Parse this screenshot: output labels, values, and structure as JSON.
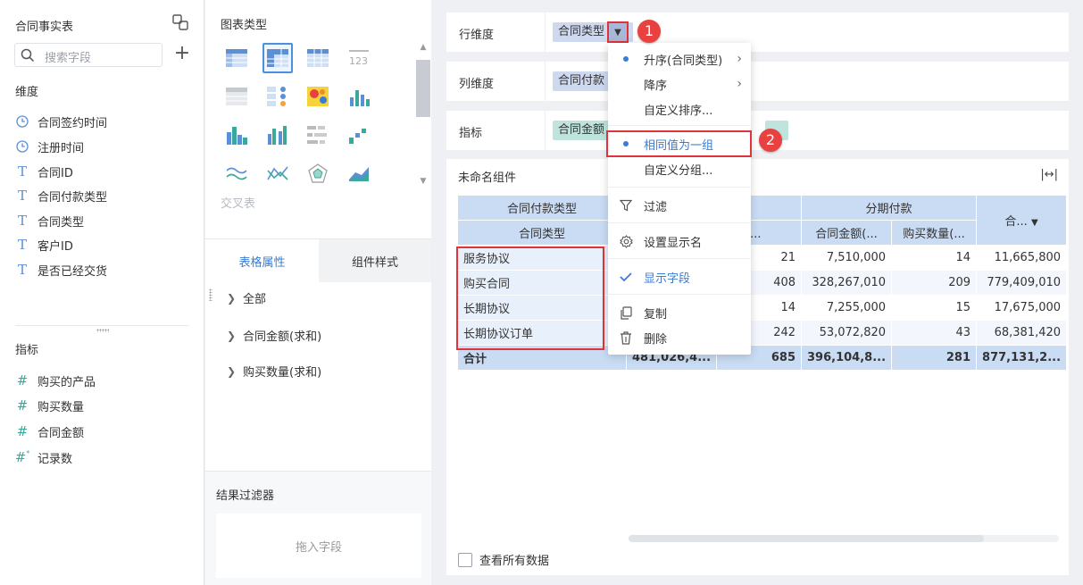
{
  "left_panel": {
    "dataset_title": "合同事实表",
    "search_placeholder": "搜索字段",
    "dimensions_title": "维度",
    "dimensions": [
      {
        "label": "合同签约时间",
        "icon": "clock-icon"
      },
      {
        "label": "注册时间",
        "icon": "clock-icon"
      },
      {
        "label": "合同ID",
        "icon": "text-type-icon"
      },
      {
        "label": "合同付款类型",
        "icon": "text-type-icon"
      },
      {
        "label": "合同类型",
        "icon": "text-type-icon"
      },
      {
        "label": "客户ID",
        "icon": "text-type-icon"
      },
      {
        "label": "是否已经交货",
        "icon": "text-type-icon"
      }
    ],
    "metrics_title": "指标",
    "metrics": [
      {
        "label": "购买的产品",
        "icon": "number-type-icon"
      },
      {
        "label": "购买数量",
        "icon": "number-type-icon"
      },
      {
        "label": "合同金额",
        "icon": "number-type-icon"
      },
      {
        "label": "记录数",
        "icon": "record-count-icon"
      }
    ]
  },
  "middle_panel": {
    "chart_type_title": "图表类型",
    "cross_table_label": "交叉表",
    "tabs": {
      "table_properties": "表格属性",
      "component_style": "组件样式"
    },
    "properties": [
      "全部",
      "合同金额(求和)",
      "购买数量(求和)"
    ],
    "result_filter_title": "结果过滤器",
    "drop_field_hint": "拖入字段"
  },
  "config": {
    "row_dim_label": "行维度",
    "row_dim_pill": "合同类型",
    "col_dim_label": "列维度",
    "col_dim_pill": "合同付款",
    "metric_label": "指标",
    "metric_pill": "合同金额"
  },
  "widget": {
    "title": "未命名组件",
    "header": {
      "payment_type": "合同付款类型",
      "contract_type": "合同类型",
      "qty_partial": "数量(...",
      "installment": "分期付款",
      "amount": "合同金额(...",
      "qty": "购买数量(...",
      "total_col": "合..."
    },
    "rows": [
      {
        "type": "服务协议",
        "c1": "",
        "c2": "21",
        "c3": "7,510,000",
        "c4": "14",
        "c5": "11,665,800"
      },
      {
        "type": "购买合同",
        "c1": "",
        "c2": "408",
        "c3": "328,267,010",
        "c4": "209",
        "c5": "779,409,010"
      },
      {
        "type": "长期协议",
        "c1": "",
        "c2": "14",
        "c3": "7,255,000",
        "c4": "15",
        "c5": "17,675,000"
      },
      {
        "type": "长期协议订单",
        "c1": "",
        "c2": "242",
        "c3": "53,072,820",
        "c4": "43",
        "c5": "68,381,420"
      }
    ],
    "total": {
      "label": "合计",
      "c1": "481,026,4...",
      "c2": "685",
      "c3": "396,104,8...",
      "c4": "281",
      "c5": "877,131,2..."
    },
    "show_all_data": "查看所有数据"
  },
  "menu": {
    "items": [
      {
        "label": "升序(合同类型)",
        "icon": "dot",
        "submenu": true
      },
      {
        "label": "降序",
        "icon": "",
        "submenu": true
      },
      {
        "label": "自定义排序...",
        "icon": "",
        "submenu": false
      },
      {
        "label": "相同值为一组",
        "icon": "dot",
        "submenu": false
      },
      {
        "label": "自定义分组...",
        "icon": "",
        "submenu": false
      },
      {
        "label": "过滤",
        "icon": "filter-icon",
        "submenu": false
      },
      {
        "label": "设置显示名",
        "icon": "settings-icon",
        "submenu": false
      },
      {
        "label": "显示字段",
        "icon": "check-icon",
        "submenu": false
      },
      {
        "label": "复制",
        "icon": "copy-icon",
        "submenu": false
      },
      {
        "label": "删除",
        "icon": "trash-icon",
        "submenu": false
      }
    ]
  },
  "annotations": {
    "badge1": "1",
    "badge2": "2"
  },
  "colors": {
    "accent": "#3a7bd5",
    "highlight_red": "#e0343a",
    "header_blue": "#c9dcf4",
    "badge_red": "#e8413f"
  }
}
